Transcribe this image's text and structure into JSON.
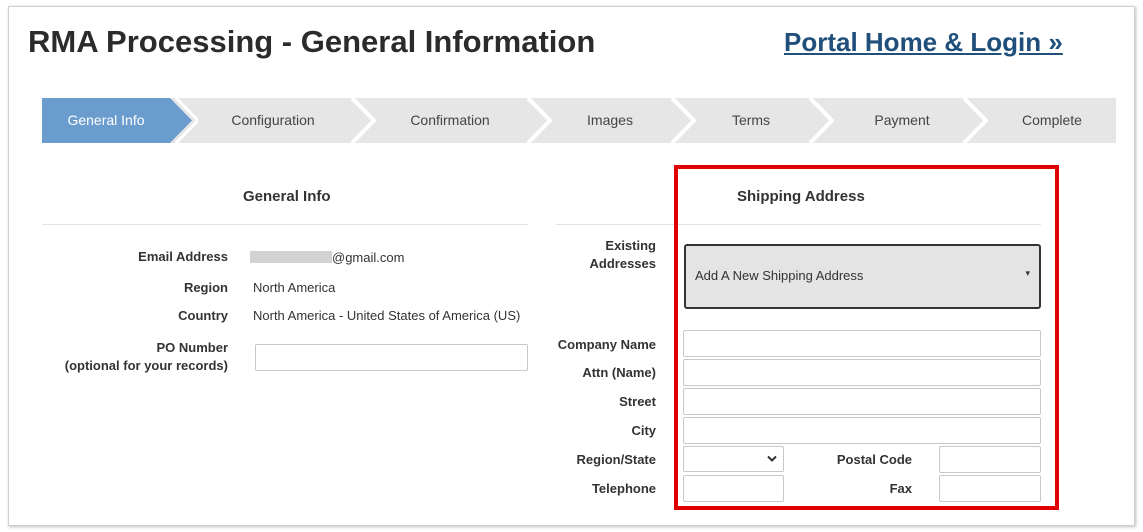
{
  "header": {
    "title": "RMA Processing - General Information",
    "portal_link": "Portal Home & Login »"
  },
  "steps": [
    {
      "label": "General Info",
      "active": true
    },
    {
      "label": "Configuration",
      "active": false
    },
    {
      "label": "Confirmation",
      "active": false
    },
    {
      "label": "Images",
      "active": false
    },
    {
      "label": "Terms",
      "active": false
    },
    {
      "label": "Payment",
      "active": false
    },
    {
      "label": "Complete",
      "active": false
    }
  ],
  "general_info": {
    "heading": "General Info",
    "email_label": "Email Address",
    "email_value": "@gmail.com",
    "region_label": "Region",
    "region_value": "North America",
    "country_label": "Country",
    "country_value": "North America - United States of America (US)",
    "po_label_line1": "PO Number",
    "po_label_line2": "(optional for your records)",
    "po_value": ""
  },
  "shipping": {
    "heading": "Shipping Address",
    "existing_label_line1": "Existing",
    "existing_label_line2": "Addresses",
    "existing_selected": "Add A New Shipping Address",
    "company_label": "Company Name",
    "attn_label": "Attn (Name)",
    "street_label": "Street",
    "city_label": "City",
    "region_label": "Region/State",
    "postal_label": "Postal Code",
    "telephone_label": "Telephone",
    "fax_label": "Fax",
    "region_selected": ""
  },
  "colors": {
    "active_step": "#6a9cce",
    "inactive_step": "#e6e6e6",
    "link": "#1f4f7a",
    "highlight": "#e00000"
  }
}
